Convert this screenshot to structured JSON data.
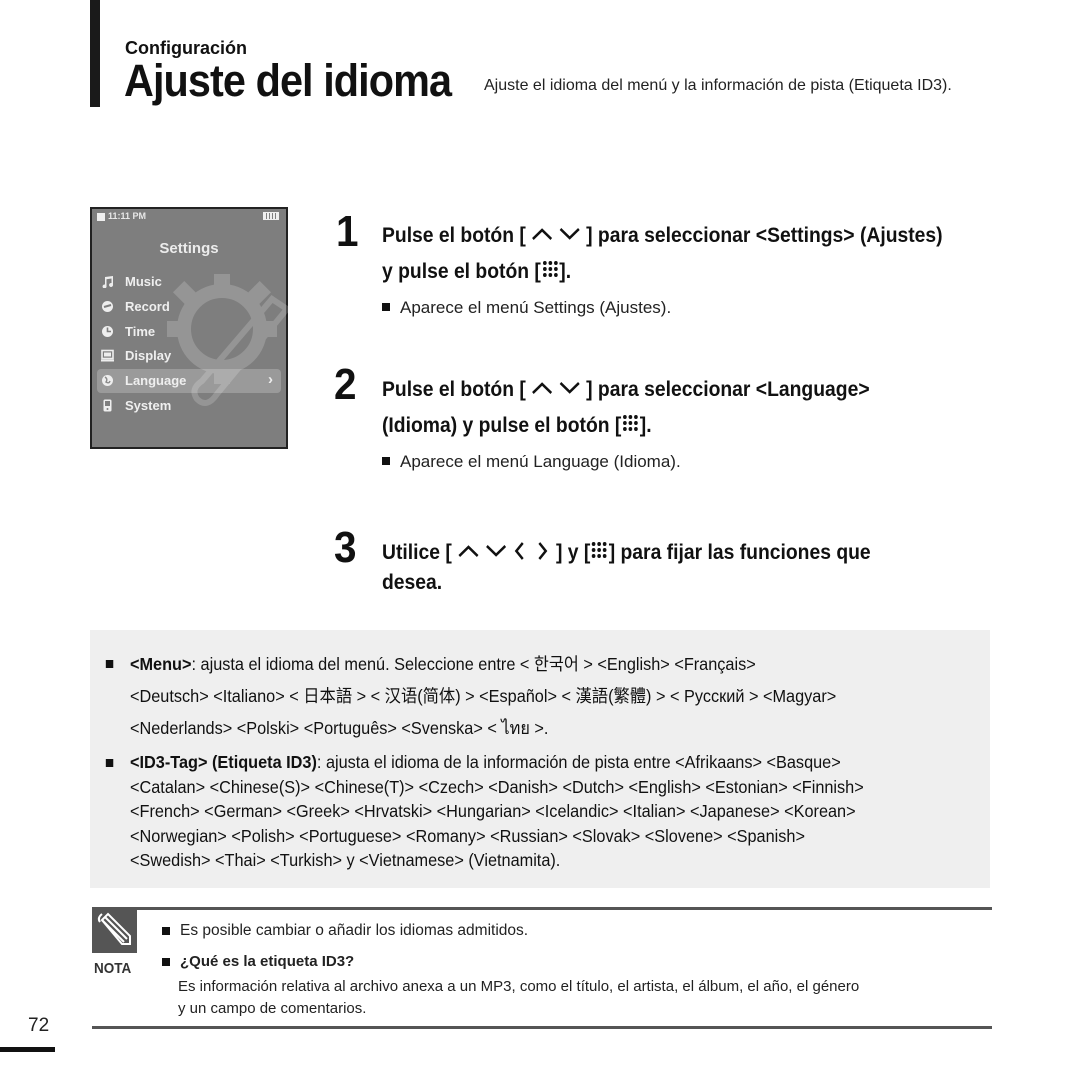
{
  "header": {
    "section": "Configuración",
    "title": "Ajuste del idioma",
    "description": "Ajuste el idioma del menú y la información de pista (Etiqueta ID3)."
  },
  "device": {
    "status_time": "11:11 PM",
    "title": "Settings",
    "menu": [
      {
        "label": "Music",
        "icon": "music-note-icon",
        "selected": false
      },
      {
        "label": "Record",
        "icon": "record-icon",
        "selected": false
      },
      {
        "label": "Time",
        "icon": "clock-icon",
        "selected": false
      },
      {
        "label": "Display",
        "icon": "display-icon",
        "selected": false
      },
      {
        "label": "Language",
        "icon": "globe-icon",
        "selected": true
      },
      {
        "label": "System",
        "icon": "system-icon",
        "selected": false
      }
    ],
    "chevron": "›"
  },
  "steps": [
    {
      "number": "1",
      "line1_a": "Pulse el botón [",
      "line1_b": "] para seleccionar <Settings> (Ajustes)",
      "line2_a": "y pulse el botón [",
      "line2_b": "].",
      "note": "Aparece el menú Settings (Ajustes)."
    },
    {
      "number": "2",
      "line1_a": "Pulse el botón [",
      "line1_b": "] para seleccionar <Language>",
      "line2_a": "(Idioma) y pulse el botón [",
      "line2_b": "].",
      "note": "Aparece el menú Language (Idioma)."
    },
    {
      "number": "3",
      "line1_a": "Utilice [",
      "line1_b": "] y [",
      "line1_c": "] para fijar las funciones que",
      "line2": "desea."
    }
  ],
  "info": {
    "menu_label": "<Menu>",
    "menu_text_1": ": ajusta el idioma del menú. Seleccione entre < 한국어 > <English> <Français>",
    "menu_text_2": "<Deutsch> <Italiano> < 日本語 > < 汉语(简体) > <Español> < 漢語(繁體) > < Русский > <Magyar>",
    "menu_text_3": "<Nederlands> <Polski> <Português> <Svenska> < ไทย >.",
    "id3_label": "<ID3-Tag> (Etiqueta ID3)",
    "id3_text_1": ": ajusta el idioma de la información de pista entre <Afrikaans> <Basque>",
    "id3_text_2": "<Catalan> <Chinese(S)> <Chinese(T)> <Czech> <Danish> <Dutch> <English> <Estonian> <Finnish>",
    "id3_text_3": "<French> <German> <Greek> <Hrvatski> <Hungarian> <Icelandic> <Italian> <Japanese> <Korean>",
    "id3_text_4": "<Norwegian> <Polish> <Portuguese> <Romany> <Russian> <Slovak> <Slovene> <Spanish>",
    "id3_text_5": "<Swedish> <Thai> <Turkish> y <Vietnamese> (Vietnamita)."
  },
  "nota": {
    "label": "NOTA",
    "item1": "Es posible cambiar o añadir los idiomas admitidos.",
    "item2_title": "¿Qué es la etiqueta ID3?",
    "item2_text_1": "Es información relativa al archivo anexa a un MP3, como el título, el artista, el álbum, el año, el género",
    "item2_text_2": "y un campo de comentarios."
  },
  "page_number": "72"
}
